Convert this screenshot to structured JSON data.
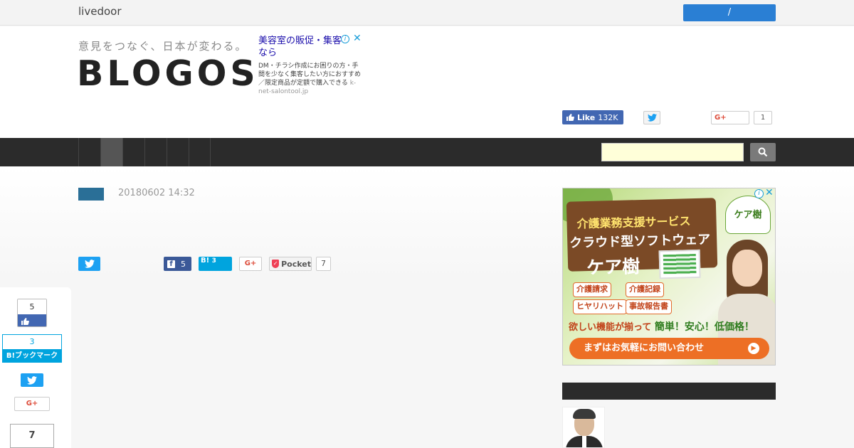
{
  "topbar": {
    "brand": "livedoor",
    "login_label": "/"
  },
  "header": {
    "tagline": "意見をつなぐ、日本が変わる。",
    "logo": "BLOGOS",
    "text_ad": {
      "title": "美容室の販促・集客なら",
      "body": "DM・チラシ作成にお困りの方・手間を少なく集客したい方におすすめ／限定商品が定額で購入できる",
      "url": "k-net-salontool.jp",
      "info_icon": "info-icon",
      "close_icon": "close-icon"
    },
    "social": {
      "fb_label": "Like",
      "fb_count": "132K",
      "gplus_label": "G+",
      "gplus_count": "1"
    }
  },
  "nav": {
    "search_placeholder": ""
  },
  "article": {
    "date": "20180602 14:32",
    "share": {
      "fb_count": "5",
      "hatena_label": "B!",
      "hatena_count": "3",
      "gplus_label": "G+",
      "pocket_label": "Pocket",
      "pocket_count": "7"
    }
  },
  "floating_share": {
    "fb_count": "5",
    "hatena_count": "3",
    "hatena_label": "B!ブックマーク",
    "gplus_label": "G+",
    "pocket_count": "7"
  },
  "sidebar_ad": {
    "line1": "介護業務支援サービス",
    "line2": "クラウド型ソフトウェア",
    "line3": "ケア樹",
    "logo": "ケア樹",
    "tags": [
      "介護請求",
      "介護記録",
      "ヒヤリハット",
      "事故報告書"
    ],
    "slogan_prefix": "欲しい機能が揃って",
    "slogan_emph": "簡単！安心！低価格！",
    "cta": "まずはお気軽にお問い合わせ"
  },
  "colors": {
    "nav_bg": "#2b2b2b",
    "login_button": "#2a7fd4",
    "facebook": "#4267b2",
    "twitter": "#1da1f2",
    "hatena": "#00a4de",
    "category_badge": "#2a6f97",
    "search_bg": "#ffffd9"
  }
}
